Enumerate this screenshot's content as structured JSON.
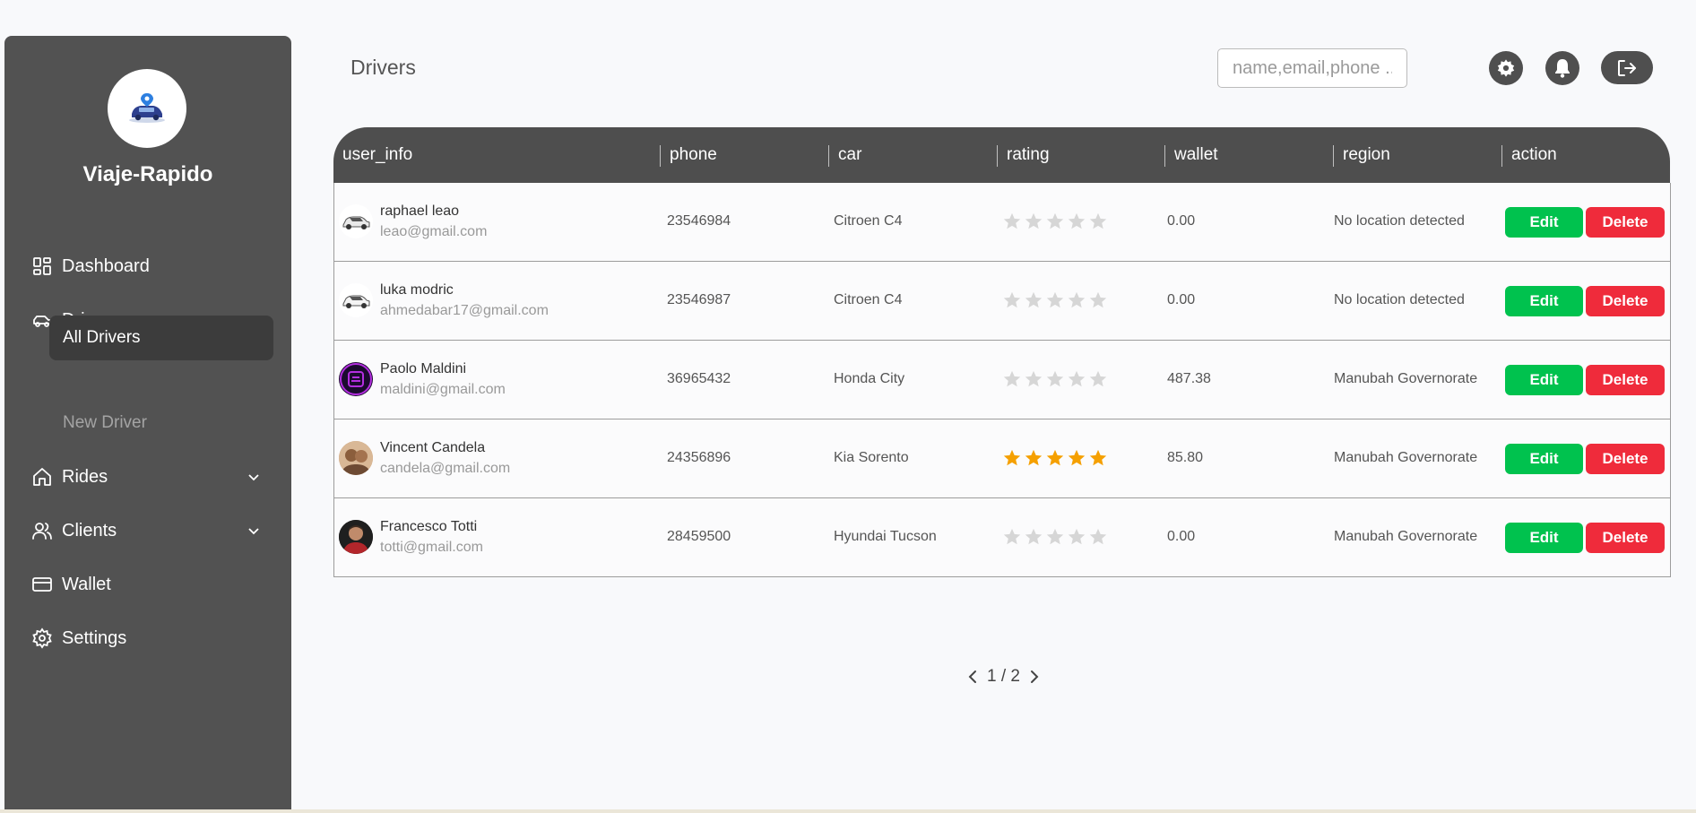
{
  "app": {
    "brand": "Viaje-Rapido"
  },
  "sidebar": {
    "items": [
      {
        "label": "Dashboard",
        "icon": "dashboard-icon"
      },
      {
        "label": "Drivers",
        "icon": "car-icon",
        "expanded": true
      },
      {
        "label": "Rides",
        "icon": "home-icon"
      },
      {
        "label": "Clients",
        "icon": "users-icon"
      },
      {
        "label": "Wallet",
        "icon": "wallet-icon"
      },
      {
        "label": "Settings",
        "icon": "gear-icon"
      }
    ],
    "drivers_sub": {
      "active": "All Drivers",
      "other": "New Driver"
    }
  },
  "header": {
    "title": "Drivers",
    "search_placeholder": "name,email,phone ..."
  },
  "table": {
    "columns": [
      "user_info",
      "phone",
      "car",
      "rating",
      "wallet",
      "region",
      "action"
    ],
    "edit_label": "Edit",
    "delete_label": "Delete",
    "rows": [
      {
        "name": "raphael leao",
        "email": "leao@gmail.com",
        "phone": "23546984",
        "car": "Citroen C4",
        "rating": 0,
        "wallet": "0.00",
        "region": "No location detected",
        "avatar": "car-avatar"
      },
      {
        "name": "luka modric",
        "email": "ahmedabar17@gmail.com",
        "phone": "23546987",
        "car": "Citroen C4",
        "rating": 0,
        "wallet": "0.00",
        "region": "No location detected",
        "avatar": "car-avatar"
      },
      {
        "name": "Paolo Maldini",
        "email": "maldini@gmail.com",
        "phone": "36965432",
        "car": "Honda City",
        "rating": 0,
        "wallet": "487.38",
        "region": "Manubah Governorate",
        "avatar": "logo-avatar"
      },
      {
        "name": "Vincent Candela",
        "email": "candela@gmail.com",
        "phone": "24356896",
        "car": "Kia Sorento",
        "rating": 5,
        "wallet": "85.80",
        "region": "Manubah Governorate",
        "avatar": "photo-avatar"
      },
      {
        "name": "Francesco Totti",
        "email": "totti@gmail.com",
        "phone": "28459500",
        "car": "Hyundai Tucson",
        "rating": 0,
        "wallet": "0.00",
        "region": "Manubah Governorate",
        "avatar": "photo-avatar"
      }
    ]
  },
  "pagination": {
    "label": "1 / 2"
  },
  "colors": {
    "sidebar": "#525252",
    "edit": "#00c24e",
    "delete": "#ef2b3b",
    "star_filled": "#f5a000",
    "star_empty": "#d6d6d6"
  }
}
